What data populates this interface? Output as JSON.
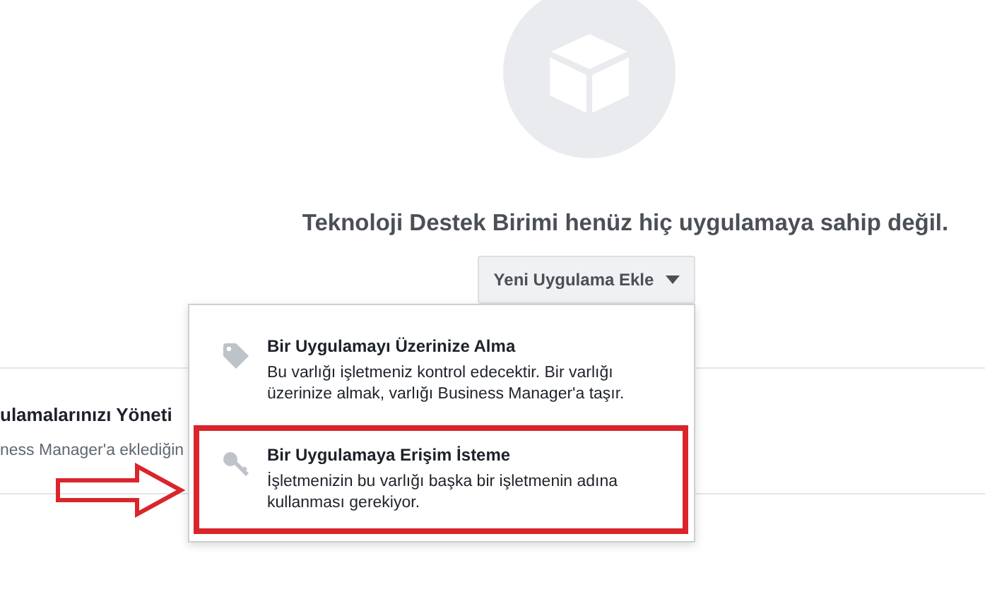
{
  "empty_state": {
    "heading": "Teknoloji Destek Birimi henüz hiç uygulamaya sahip değil.",
    "add_button": {
      "label": "Yeni Uygulama Ekle",
      "expanded": true
    }
  },
  "section": {
    "title": "ulamalarınızı Yöneti",
    "subtitle": "ness Manager'a eklediğin"
  },
  "menu": [
    {
      "kind": "tag",
      "title": "Bir Uygulamayı Üzerinize Alma",
      "description": "Bu varlığı işletmeniz kontrol edecektir. Bir varlığı üzerinize almak, varlığı Business Manager'a taşır.",
      "highlighted": false
    },
    {
      "kind": "key",
      "title": "Bir Uygulamaya Erişim İsteme",
      "description": "İşletmenizin bu varlığı başka bir işletmenin adına kullanması gerekiyor.",
      "highlighted": true
    }
  ]
}
